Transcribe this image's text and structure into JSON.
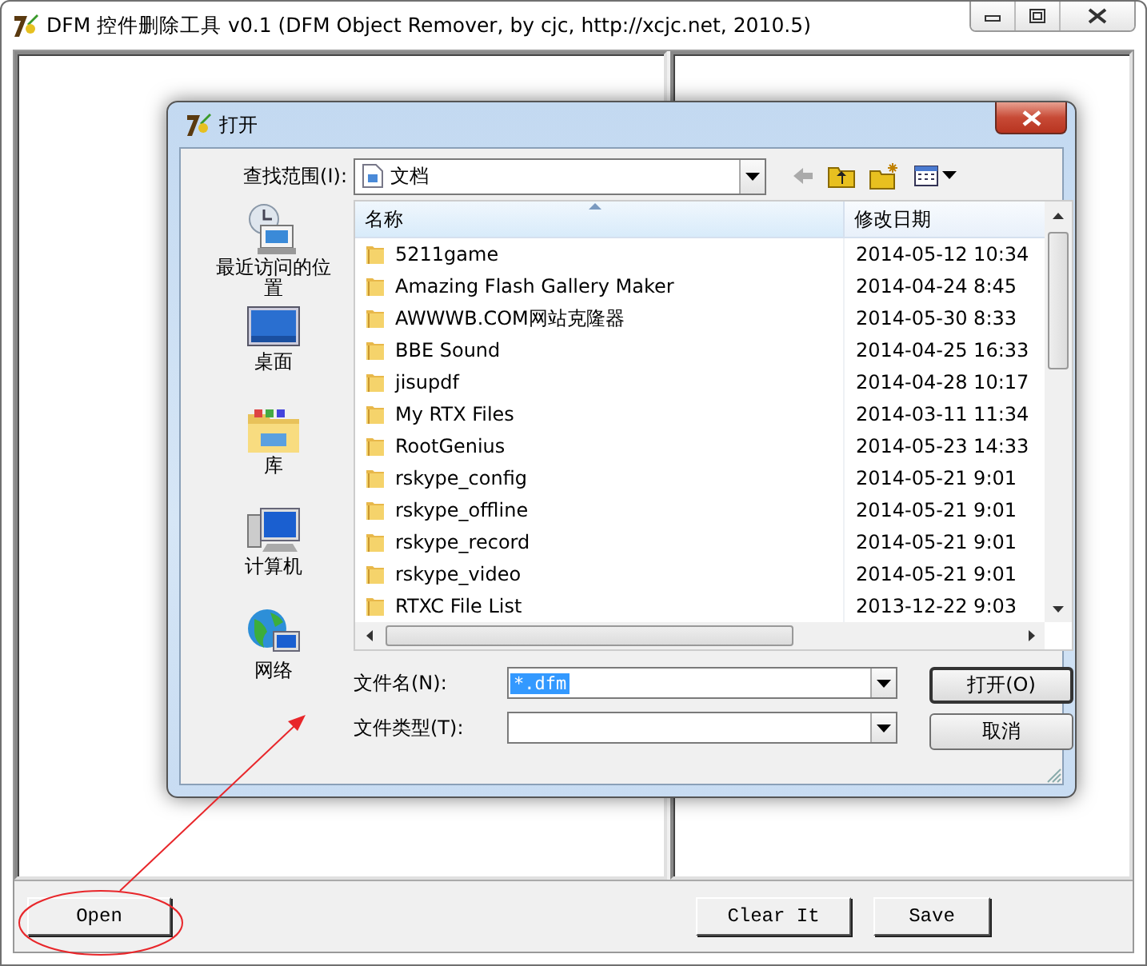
{
  "window": {
    "title": "DFM 控件删除工具 v0.1  (DFM Object Remover,  by cjc, http://xcjc.net, 2010.5)"
  },
  "buttons": [
    {
      "label": "Open"
    },
    {
      "label": "Clear It"
    },
    {
      "label": "Save"
    }
  ],
  "dialog": {
    "title": "打开",
    "look_in": {
      "label": "查找范围(I):",
      "value": "文档"
    },
    "places": [
      {
        "kind": "recent",
        "label": "最近访问的位置"
      },
      {
        "kind": "desktop",
        "label": "桌面"
      },
      {
        "kind": "library",
        "label": "库"
      },
      {
        "kind": "computer",
        "label": "计算机"
      },
      {
        "kind": "network",
        "label": "网络"
      }
    ],
    "columns": [
      "名称",
      "修改日期"
    ],
    "files": [
      {
        "name": "5211game",
        "modified": "2014-05-12 10:34"
      },
      {
        "name": "Amazing Flash Gallery Maker",
        "modified": "2014-04-24 8:45"
      },
      {
        "name": "AWWWB.COM网站克隆器",
        "modified": "2014-05-30 8:33"
      },
      {
        "name": "BBE Sound",
        "modified": "2014-04-25 16:33"
      },
      {
        "name": "jisupdf",
        "modified": "2014-04-28 10:17"
      },
      {
        "name": "My RTX Files",
        "modified": "2014-03-11 11:34"
      },
      {
        "name": "RootGenius",
        "modified": "2014-05-23 14:33"
      },
      {
        "name": "rskype_config",
        "modified": "2014-05-21 9:01"
      },
      {
        "name": "rskype_offline",
        "modified": "2014-05-21 9:01"
      },
      {
        "name": "rskype_record",
        "modified": "2014-05-21 9:01"
      },
      {
        "name": "rskype_video",
        "modified": "2014-05-21 9:01"
      },
      {
        "name": "RTXC File List",
        "modified": "2013-12-22 9:03"
      }
    ],
    "file_name": {
      "label": "文件名(N):",
      "value": "*.dfm",
      "selected": true
    },
    "file_type": {
      "label": "文件类型(T):"
    },
    "buttons": [
      "打开(O)",
      "取消"
    ]
  }
}
